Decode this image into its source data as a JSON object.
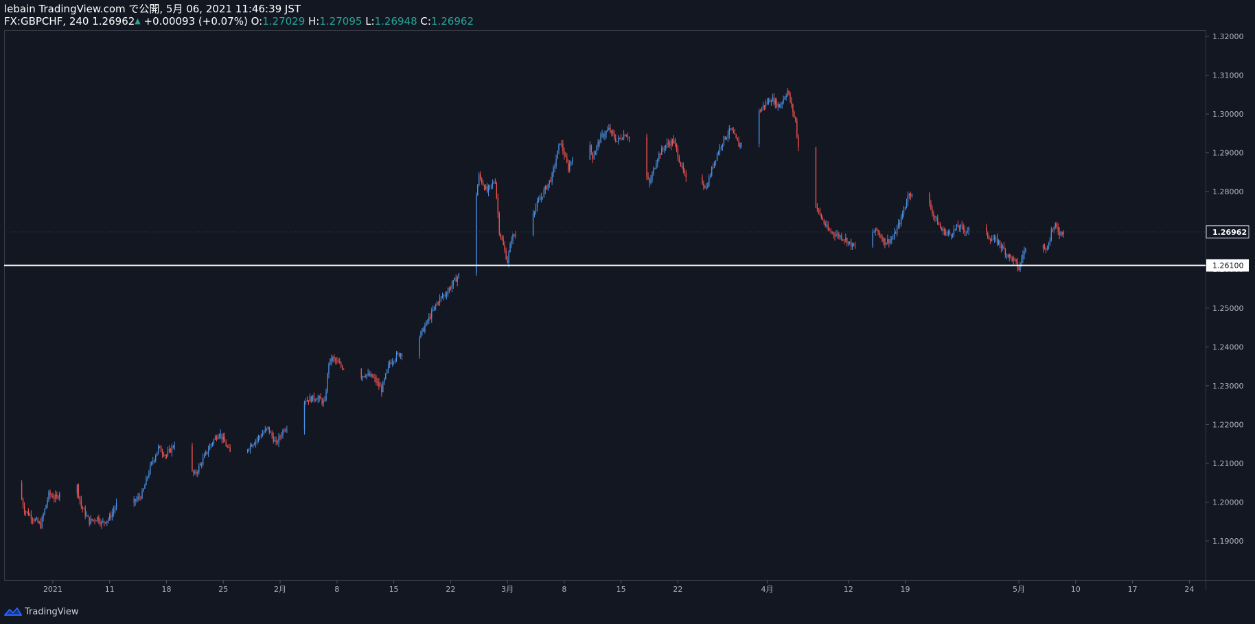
{
  "header": {
    "publish_line": "lebain TradingView.com で公開, 5月 06, 2021 11:46:39 JST",
    "symbol": "FX:GBPCHF, 240",
    "last": "1.26962",
    "change": "+0.00093 (+0.07%)",
    "ohlc": {
      "o_label": "O:",
      "o": "1.27029",
      "h_label": "H:",
      "h": "1.27095",
      "l_label": "L:",
      "l": "1.26948",
      "c_label": "C:",
      "c": "1.26962"
    }
  },
  "footer": {
    "brand": "TradingView"
  },
  "colors": {
    "background": "#131722",
    "up": "#2962ff",
    "up_light": "#4a90e2",
    "down": "#ef5350",
    "level_line": "#ffffff",
    "axis_text": "#b2b5be",
    "border": "#363a45"
  },
  "chart_data": {
    "type": "line",
    "subtype": "candlestick (4h)",
    "symbol": "GBPCHF",
    "ylim": [
      1.1815,
      1.322
    ],
    "y_ticks": [
      "1.32000",
      "1.31000",
      "1.30000",
      "1.29000",
      "1.28000",
      "1.27000",
      "1.26000",
      "1.25000",
      "1.24000",
      "1.23000",
      "1.22000",
      "1.21000",
      "1.20000",
      "1.19000"
    ],
    "x_ticks": [
      {
        "day": -3,
        "label": "2021"
      },
      {
        "day": 4,
        "label": "11"
      },
      {
        "day": 11,
        "label": "18"
      },
      {
        "day": 18,
        "label": "25"
      },
      {
        "day": 25,
        "label": "2月"
      },
      {
        "day": 32,
        "label": "8"
      },
      {
        "day": 39,
        "label": "15"
      },
      {
        "day": 46,
        "label": "22"
      },
      {
        "day": 53,
        "label": "3月"
      },
      {
        "day": 60,
        "label": "8"
      },
      {
        "day": 67,
        "label": "15"
      },
      {
        "day": 74,
        "label": "22"
      },
      {
        "day": 85,
        "label": "4月"
      },
      {
        "day": 95,
        "label": "12"
      },
      {
        "day": 102,
        "label": "19"
      },
      {
        "day": 116,
        "label": "5月"
      },
      {
        "day": 123,
        "label": "10"
      },
      {
        "day": 130,
        "label": "17"
      },
      {
        "day": 137,
        "label": "24"
      }
    ],
    "x_range_days": [
      -9,
      139
    ],
    "last_day": 121.5,
    "current_price": 1.26962,
    "current_price_label": "1.26962",
    "level_line": 1.261,
    "level_label": "1.26100",
    "price_path": [
      [
        -9.0,
        1.205
      ],
      [
        -8.5,
        1.21
      ],
      [
        -7.5,
        1.206
      ],
      [
        -6.5,
        1.198
      ],
      [
        -5.5,
        1.196
      ],
      [
        -4.5,
        1.194
      ],
      [
        -3.5,
        1.202
      ],
      [
        -2.5,
        1.201
      ],
      [
        -1.5,
        1.206
      ],
      [
        -0.5,
        1.209
      ],
      [
        0.5,
        1.199
      ],
      [
        1.5,
        1.195
      ],
      [
        2.5,
        1.196
      ],
      [
        3.0,
        1.1945
      ],
      [
        4.0,
        1.196
      ],
      [
        5.0,
        1.2
      ],
      [
        6.0,
        1.204
      ],
      [
        7.0,
        1.2
      ],
      [
        8.0,
        1.202
      ],
      [
        9.0,
        1.209
      ],
      [
        10.0,
        1.214
      ],
      [
        11.0,
        1.212
      ],
      [
        12.0,
        1.215
      ],
      [
        12.5,
        1.21
      ],
      [
        13.5,
        1.209
      ],
      [
        14.5,
        1.207
      ],
      [
        15.5,
        1.211
      ],
      [
        16.5,
        1.215
      ],
      [
        17.5,
        1.218
      ],
      [
        18.5,
        1.214
      ],
      [
        19.5,
        1.21
      ],
      [
        20.5,
        1.213
      ],
      [
        21.5,
        1.215
      ],
      [
        22.5,
        1.217
      ],
      [
        23.5,
        1.219
      ],
      [
        24.5,
        1.215
      ],
      [
        25.5,
        1.219
      ],
      [
        26.5,
        1.22
      ],
      [
        27.5,
        1.226
      ],
      [
        28.5,
        1.2265
      ],
      [
        29.5,
        1.227
      ],
      [
        30.5,
        1.2255
      ],
      [
        31.0,
        1.236
      ],
      [
        31.5,
        1.237
      ],
      [
        32.5,
        1.235
      ],
      [
        33.5,
        1.234
      ],
      [
        34.5,
        1.232
      ],
      [
        35.5,
        1.233
      ],
      [
        36.5,
        1.232
      ],
      [
        37.5,
        1.229
      ],
      [
        38.5,
        1.236
      ],
      [
        39.5,
        1.238
      ],
      [
        40.5,
        1.239
      ],
      [
        41.5,
        1.24
      ],
      [
        42.5,
        1.244
      ],
      [
        43.5,
        1.248
      ],
      [
        44.5,
        1.252
      ],
      [
        45.5,
        1.254
      ],
      [
        46.5,
        1.257
      ],
      [
        47.5,
        1.26
      ],
      [
        48.5,
        1.264
      ],
      [
        49.0,
        1.277
      ],
      [
        49.5,
        1.284
      ],
      [
        50.5,
        1.28
      ],
      [
        51.5,
        1.283
      ],
      [
        52.0,
        1.27
      ],
      [
        52.5,
        1.266
      ],
      [
        53.0,
        1.262
      ],
      [
        53.5,
        1.268
      ],
      [
        54.5,
        1.27
      ],
      [
        55.5,
        1.273
      ],
      [
        56.5,
        1.276
      ],
      [
        57.5,
        1.28
      ],
      [
        58.5,
        1.284
      ],
      [
        59.5,
        1.293
      ],
      [
        60.5,
        1.286
      ],
      [
        61.5,
        1.292
      ],
      [
        62.5,
        1.296
      ],
      [
        63.5,
        1.289
      ],
      [
        64.5,
        1.294
      ],
      [
        65.5,
        1.296
      ],
      [
        66.5,
        1.293
      ],
      [
        67.5,
        1.295
      ],
      [
        68.5,
        1.293
      ],
      [
        69.5,
        1.287
      ],
      [
        70.5,
        1.282
      ],
      [
        71.5,
        1.289
      ],
      [
        72.5,
        1.292
      ],
      [
        73.5,
        1.293
      ],
      [
        74.5,
        1.286
      ],
      [
        75.5,
        1.28
      ],
      [
        76.5,
        1.284
      ],
      [
        77.5,
        1.281
      ],
      [
        78.5,
        1.288
      ],
      [
        79.5,
        1.293
      ],
      [
        80.5,
        1.296
      ],
      [
        81.5,
        1.292
      ],
      [
        82.5,
        1.294
      ],
      [
        83.5,
        1.299
      ],
      [
        84.5,
        1.302
      ],
      [
        85.5,
        1.304
      ],
      [
        86.5,
        1.302
      ],
      [
        87.5,
        1.306
      ],
      [
        88.0,
        1.302
      ],
      [
        88.5,
        1.298
      ],
      [
        89.0,
        1.288
      ],
      [
        89.5,
        1.284
      ],
      [
        90.5,
        1.279
      ],
      [
        91.5,
        1.274
      ],
      [
        92.5,
        1.27
      ],
      [
        93.5,
        1.269
      ],
      [
        94.5,
        1.268
      ],
      [
        95.5,
        1.266
      ],
      [
        96.5,
        1.265
      ],
      [
        97.5,
        1.269
      ],
      [
        98.5,
        1.27
      ],
      [
        99.5,
        1.267
      ],
      [
        100.5,
        1.268
      ],
      [
        101.5,
        1.273
      ],
      [
        102.5,
        1.28
      ],
      [
        103.5,
        1.277
      ],
      [
        104.5,
        1.279
      ],
      [
        105.5,
        1.274
      ],
      [
        106.5,
        1.27
      ],
      [
        107.5,
        1.269
      ],
      [
        108.5,
        1.271
      ],
      [
        109.5,
        1.27
      ],
      [
        110.5,
        1.271
      ],
      [
        111.5,
        1.27
      ],
      [
        112.5,
        1.268
      ],
      [
        113.5,
        1.267
      ],
      [
        114.5,
        1.264
      ],
      [
        115.5,
        1.262
      ],
      [
        116.0,
        1.26
      ],
      [
        116.5,
        1.264
      ],
      [
        117.5,
        1.267
      ],
      [
        118.5,
        1.269
      ],
      [
        119.5,
        1.265
      ],
      [
        120.0,
        1.27
      ],
      [
        120.5,
        1.271
      ],
      [
        121.0,
        1.2695
      ],
      [
        121.5,
        1.2696
      ]
    ]
  }
}
